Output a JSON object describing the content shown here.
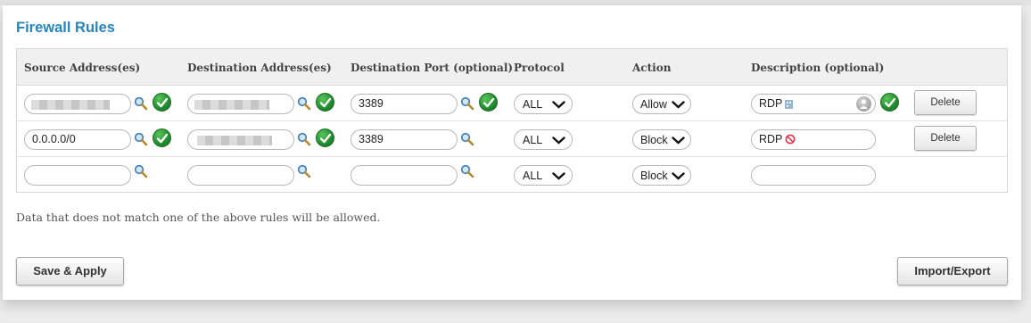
{
  "panel": {
    "title": "Firewall Rules"
  },
  "table": {
    "headers": [
      "Source Address(es)",
      "Destination Address(es)",
      "Destination Port (optional)",
      "Protocol",
      "Action",
      "Description (optional)"
    ],
    "rows": [
      {
        "source": "",
        "destination": "",
        "port": "3389",
        "protocol": "ALL",
        "action": "Allow",
        "description": "RDP",
        "delete_label": "Delete"
      },
      {
        "source": "0.0.0.0/0",
        "destination": "",
        "port": "3389",
        "protocol": "ALL",
        "action": "Block",
        "description": "RDP",
        "delete_label": "Delete"
      },
      {
        "source": "",
        "destination": "",
        "port": "",
        "protocol": "ALL",
        "action": "Block",
        "description": ""
      }
    ]
  },
  "note": "Data that does not match one of the above rules will be allowed.",
  "buttons": {
    "save_apply": "Save & Apply",
    "import_export": "Import/Export"
  },
  "colors": {
    "title": "#2585bd",
    "check": "#1f8c2d",
    "block_icon": "#e2364a"
  }
}
